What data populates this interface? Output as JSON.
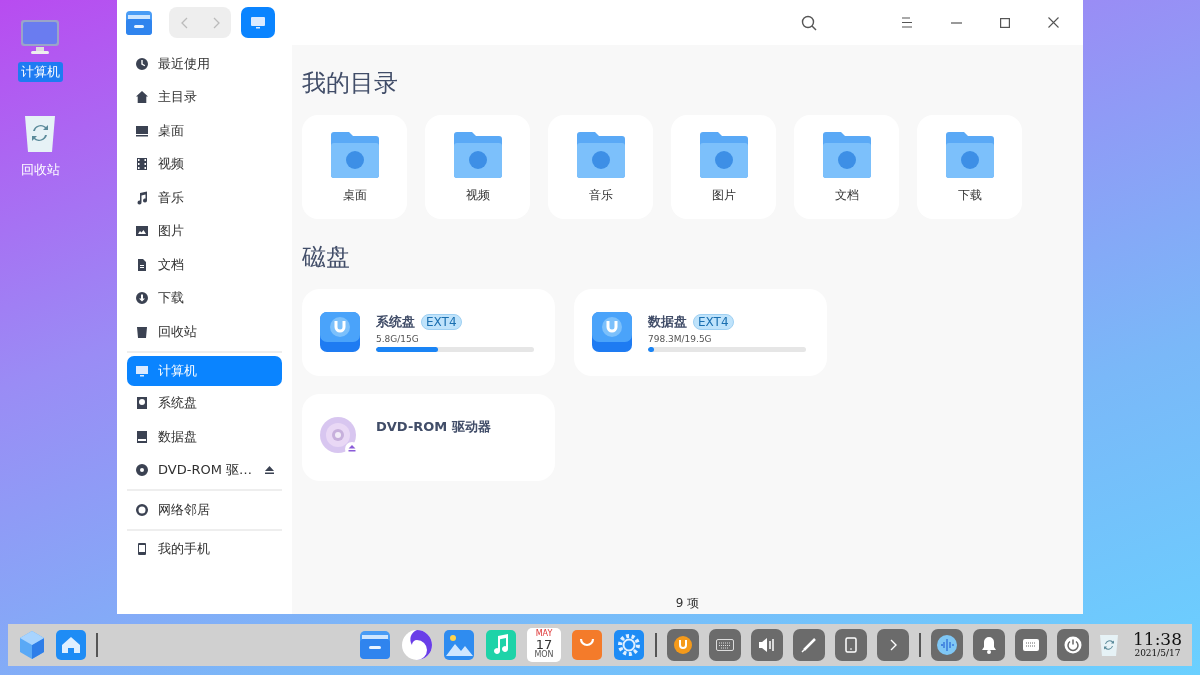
{
  "desktop_icons": [
    {
      "label": "计算机",
      "selected": true
    },
    {
      "label": "回收站",
      "selected": false
    }
  ],
  "window": {
    "status_bar": "9 项"
  },
  "sidebar": {
    "groups": [
      [
        {
          "label": "最近使用",
          "selected": false
        },
        {
          "label": "主目录",
          "selected": false
        },
        {
          "label": "桌面",
          "selected": false
        },
        {
          "label": "视频",
          "selected": false
        },
        {
          "label": "音乐",
          "selected": false
        },
        {
          "label": "图片",
          "selected": false
        },
        {
          "label": "文档",
          "selected": false
        },
        {
          "label": "下载",
          "selected": false
        },
        {
          "label": "回收站",
          "selected": false
        }
      ],
      [
        {
          "label": "计算机",
          "selected": true
        },
        {
          "label": "系统盘",
          "selected": false
        },
        {
          "label": "数据盘",
          "selected": false
        },
        {
          "label": "DVD-ROM 驱…",
          "selected": false,
          "ejectable": true
        }
      ],
      [
        {
          "label": "网络邻居",
          "selected": false
        }
      ],
      [
        {
          "label": "我的手机",
          "selected": false
        }
      ]
    ]
  },
  "my_directory": {
    "title": "我的目录",
    "folders": [
      "桌面",
      "视频",
      "音乐",
      "图片",
      "文档",
      "下载"
    ]
  },
  "disks": {
    "title": "磁盘",
    "items": [
      {
        "kind": "drive",
        "name": "系统盘",
        "fs": "EXT4",
        "usage": "5.8G/15G",
        "level": 0.39
      },
      {
        "kind": "drive",
        "name": "数据盘",
        "fs": "EXT4",
        "usage": "798.3M/19.5G",
        "level": 0.04
      },
      {
        "kind": "optical",
        "name": "DVD-ROM 驱动器"
      }
    ]
  },
  "dock": {
    "calendar": {
      "month": "MAY",
      "day": "17",
      "weekday": "MON"
    },
    "time": "11:38",
    "date": "2021/5/17"
  }
}
